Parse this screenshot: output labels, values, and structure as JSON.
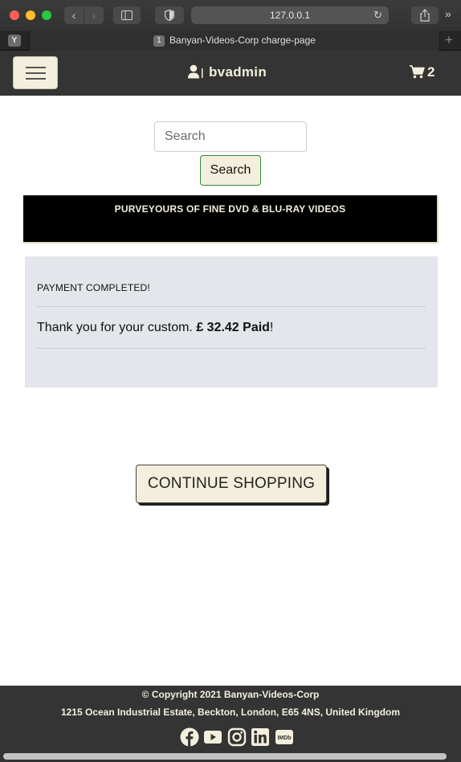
{
  "browser": {
    "url": "127.0.0.1",
    "tab_title": "Banyan-Videos-Corp charge-page",
    "tab_number": "1",
    "pinned_favicon_letter": "Y"
  },
  "navbar": {
    "username": "bvadmin",
    "cart_count": "2",
    "icons": [
      "menu-icon",
      "user-icon",
      "cart-icon"
    ]
  },
  "search": {
    "placeholder": "Search",
    "button_label": "Search"
  },
  "banner": {
    "tagline": "PURVEYOURS OF FINE DVD & BLU-RAY VIDEOS"
  },
  "payment": {
    "status": "PAYMENT COMPLETED!",
    "thanks_text": "Thank you for your custom.",
    "amount_text": "£ 32.42 Paid",
    "exclaim": "!"
  },
  "continue_button": "CONTINUE SHOPPING",
  "footer": {
    "copyright": "© Copyright 2021 Banyan-Videos-Corp",
    "address": "1215 Ocean Industrial Estate, Beckton, London, E65 4NS, United Kingdom",
    "social_icons": [
      "facebook-icon",
      "youtube-icon",
      "instagram-icon",
      "linkedin-icon",
      "imdb-icon"
    ],
    "imdb_label": "IMDb"
  },
  "colors": {
    "navbar_bg": "#343434",
    "cream": "#f4efdc",
    "card_bg": "#e3e6ea"
  }
}
